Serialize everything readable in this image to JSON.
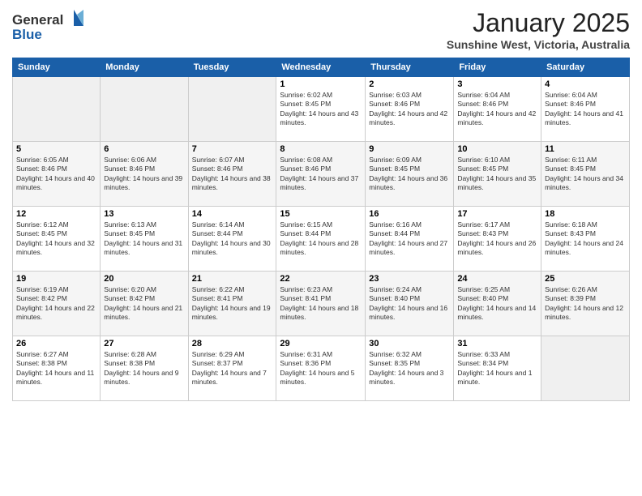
{
  "header": {
    "logo_general": "General",
    "logo_blue": "Blue",
    "month_title": "January 2025",
    "subtitle": "Sunshine West, Victoria, Australia"
  },
  "weekdays": [
    "Sunday",
    "Monday",
    "Tuesday",
    "Wednesday",
    "Thursday",
    "Friday",
    "Saturday"
  ],
  "weeks": [
    [
      {
        "day": "",
        "sunrise": "",
        "sunset": "",
        "daylight": ""
      },
      {
        "day": "",
        "sunrise": "",
        "sunset": "",
        "daylight": ""
      },
      {
        "day": "",
        "sunrise": "",
        "sunset": "",
        "daylight": ""
      },
      {
        "day": "1",
        "sunrise": "Sunrise: 6:02 AM",
        "sunset": "Sunset: 8:45 PM",
        "daylight": "Daylight: 14 hours and 43 minutes."
      },
      {
        "day": "2",
        "sunrise": "Sunrise: 6:03 AM",
        "sunset": "Sunset: 8:46 PM",
        "daylight": "Daylight: 14 hours and 42 minutes."
      },
      {
        "day": "3",
        "sunrise": "Sunrise: 6:04 AM",
        "sunset": "Sunset: 8:46 PM",
        "daylight": "Daylight: 14 hours and 42 minutes."
      },
      {
        "day": "4",
        "sunrise": "Sunrise: 6:04 AM",
        "sunset": "Sunset: 8:46 PM",
        "daylight": "Daylight: 14 hours and 41 minutes."
      }
    ],
    [
      {
        "day": "5",
        "sunrise": "Sunrise: 6:05 AM",
        "sunset": "Sunset: 8:46 PM",
        "daylight": "Daylight: 14 hours and 40 minutes."
      },
      {
        "day": "6",
        "sunrise": "Sunrise: 6:06 AM",
        "sunset": "Sunset: 8:46 PM",
        "daylight": "Daylight: 14 hours and 39 minutes."
      },
      {
        "day": "7",
        "sunrise": "Sunrise: 6:07 AM",
        "sunset": "Sunset: 8:46 PM",
        "daylight": "Daylight: 14 hours and 38 minutes."
      },
      {
        "day": "8",
        "sunrise": "Sunrise: 6:08 AM",
        "sunset": "Sunset: 8:46 PM",
        "daylight": "Daylight: 14 hours and 37 minutes."
      },
      {
        "day": "9",
        "sunrise": "Sunrise: 6:09 AM",
        "sunset": "Sunset: 8:45 PM",
        "daylight": "Daylight: 14 hours and 36 minutes."
      },
      {
        "day": "10",
        "sunrise": "Sunrise: 6:10 AM",
        "sunset": "Sunset: 8:45 PM",
        "daylight": "Daylight: 14 hours and 35 minutes."
      },
      {
        "day": "11",
        "sunrise": "Sunrise: 6:11 AM",
        "sunset": "Sunset: 8:45 PM",
        "daylight": "Daylight: 14 hours and 34 minutes."
      }
    ],
    [
      {
        "day": "12",
        "sunrise": "Sunrise: 6:12 AM",
        "sunset": "Sunset: 8:45 PM",
        "daylight": "Daylight: 14 hours and 32 minutes."
      },
      {
        "day": "13",
        "sunrise": "Sunrise: 6:13 AM",
        "sunset": "Sunset: 8:45 PM",
        "daylight": "Daylight: 14 hours and 31 minutes."
      },
      {
        "day": "14",
        "sunrise": "Sunrise: 6:14 AM",
        "sunset": "Sunset: 8:44 PM",
        "daylight": "Daylight: 14 hours and 30 minutes."
      },
      {
        "day": "15",
        "sunrise": "Sunrise: 6:15 AM",
        "sunset": "Sunset: 8:44 PM",
        "daylight": "Daylight: 14 hours and 28 minutes."
      },
      {
        "day": "16",
        "sunrise": "Sunrise: 6:16 AM",
        "sunset": "Sunset: 8:44 PM",
        "daylight": "Daylight: 14 hours and 27 minutes."
      },
      {
        "day": "17",
        "sunrise": "Sunrise: 6:17 AM",
        "sunset": "Sunset: 8:43 PM",
        "daylight": "Daylight: 14 hours and 26 minutes."
      },
      {
        "day": "18",
        "sunrise": "Sunrise: 6:18 AM",
        "sunset": "Sunset: 8:43 PM",
        "daylight": "Daylight: 14 hours and 24 minutes."
      }
    ],
    [
      {
        "day": "19",
        "sunrise": "Sunrise: 6:19 AM",
        "sunset": "Sunset: 8:42 PM",
        "daylight": "Daylight: 14 hours and 22 minutes."
      },
      {
        "day": "20",
        "sunrise": "Sunrise: 6:20 AM",
        "sunset": "Sunset: 8:42 PM",
        "daylight": "Daylight: 14 hours and 21 minutes."
      },
      {
        "day": "21",
        "sunrise": "Sunrise: 6:22 AM",
        "sunset": "Sunset: 8:41 PM",
        "daylight": "Daylight: 14 hours and 19 minutes."
      },
      {
        "day": "22",
        "sunrise": "Sunrise: 6:23 AM",
        "sunset": "Sunset: 8:41 PM",
        "daylight": "Daylight: 14 hours and 18 minutes."
      },
      {
        "day": "23",
        "sunrise": "Sunrise: 6:24 AM",
        "sunset": "Sunset: 8:40 PM",
        "daylight": "Daylight: 14 hours and 16 minutes."
      },
      {
        "day": "24",
        "sunrise": "Sunrise: 6:25 AM",
        "sunset": "Sunset: 8:40 PM",
        "daylight": "Daylight: 14 hours and 14 minutes."
      },
      {
        "day": "25",
        "sunrise": "Sunrise: 6:26 AM",
        "sunset": "Sunset: 8:39 PM",
        "daylight": "Daylight: 14 hours and 12 minutes."
      }
    ],
    [
      {
        "day": "26",
        "sunrise": "Sunrise: 6:27 AM",
        "sunset": "Sunset: 8:38 PM",
        "daylight": "Daylight: 14 hours and 11 minutes."
      },
      {
        "day": "27",
        "sunrise": "Sunrise: 6:28 AM",
        "sunset": "Sunset: 8:38 PM",
        "daylight": "Daylight: 14 hours and 9 minutes."
      },
      {
        "day": "28",
        "sunrise": "Sunrise: 6:29 AM",
        "sunset": "Sunset: 8:37 PM",
        "daylight": "Daylight: 14 hours and 7 minutes."
      },
      {
        "day": "29",
        "sunrise": "Sunrise: 6:31 AM",
        "sunset": "Sunset: 8:36 PM",
        "daylight": "Daylight: 14 hours and 5 minutes."
      },
      {
        "day": "30",
        "sunrise": "Sunrise: 6:32 AM",
        "sunset": "Sunset: 8:35 PM",
        "daylight": "Daylight: 14 hours and 3 minutes."
      },
      {
        "day": "31",
        "sunrise": "Sunrise: 6:33 AM",
        "sunset": "Sunset: 8:34 PM",
        "daylight": "Daylight: 14 hours and 1 minute."
      },
      {
        "day": "",
        "sunrise": "",
        "sunset": "",
        "daylight": ""
      }
    ]
  ]
}
